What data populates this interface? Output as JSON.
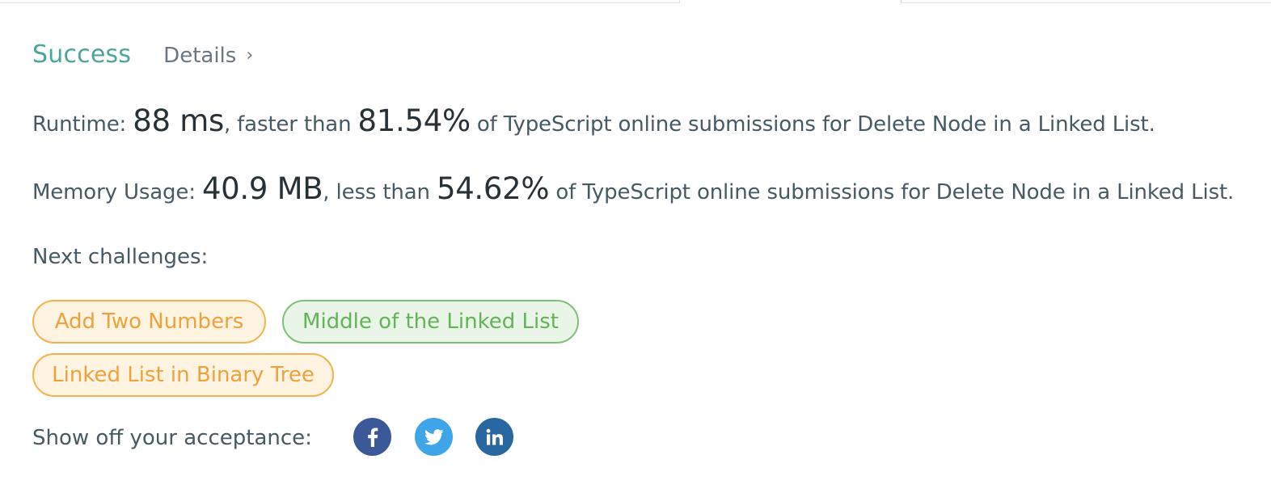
{
  "result": {
    "status": "Success",
    "details_label": "Details",
    "details_chevron": "›"
  },
  "runtime": {
    "label": "Runtime: ",
    "value": "88 ms",
    "comparison": ", faster than ",
    "percent": "81.54%",
    "suffix": " of TypeScript online submissions for Delete Node in a Linked List."
  },
  "memory": {
    "label": "Memory Usage: ",
    "value": "40.9 MB",
    "comparison": ", less than ",
    "percent": "54.62%",
    "suffix": " of TypeScript online submissions for Delete Node in a Linked List."
  },
  "next_challenges": {
    "label": "Next challenges:",
    "items": [
      {
        "label": "Add Two Numbers",
        "difficulty": "medium"
      },
      {
        "label": "Middle of the Linked List",
        "difficulty": "easy"
      },
      {
        "label": "Linked List in Binary Tree",
        "difficulty": "medium"
      }
    ]
  },
  "share": {
    "label": "Show off your acceptance:",
    "buttons": [
      {
        "network": "facebook",
        "icon": "facebook-icon",
        "color": "#3b5998"
      },
      {
        "network": "twitter",
        "icon": "twitter-icon",
        "color": "#3ea6e8"
      },
      {
        "network": "linkedin",
        "icon": "linkedin-icon",
        "color": "#28679f"
      }
    ]
  },
  "colors": {
    "success": "#4aa79b",
    "medium_text": "#efa23c",
    "medium_bg": "#fff3e2",
    "easy_text": "#64b25a",
    "easy_bg": "#e9f5e6"
  }
}
